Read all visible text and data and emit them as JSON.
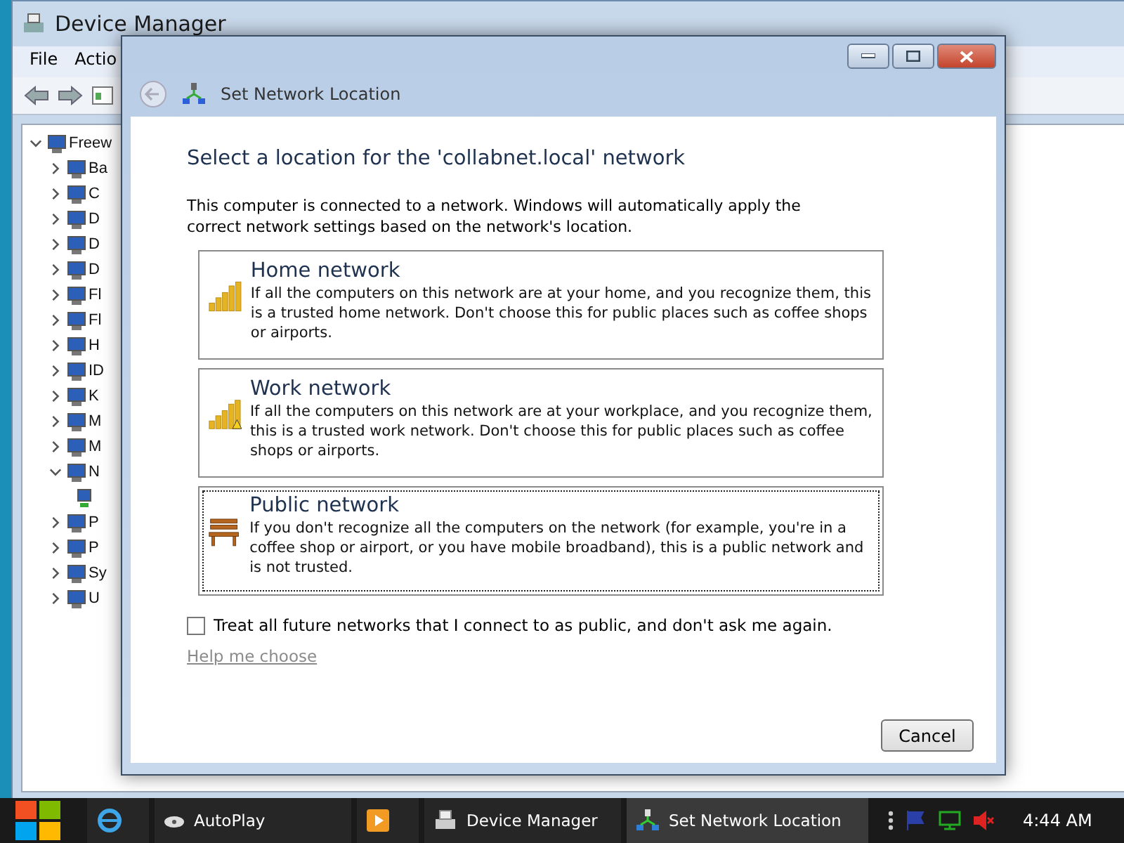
{
  "device_manager": {
    "title": "Device Manager",
    "menu": [
      "File",
      "Actio"
    ],
    "tree": [
      {
        "label": "Freew",
        "expanded": true,
        "children": [
          {
            "label": "Ba",
            "expanded": false
          },
          {
            "label": "C",
            "expanded": false
          },
          {
            "label": "D",
            "expanded": false
          },
          {
            "label": "D",
            "expanded": false
          },
          {
            "label": "D",
            "expanded": false
          },
          {
            "label": "Fl",
            "expanded": false
          },
          {
            "label": "Fl",
            "expanded": false
          },
          {
            "label": "H",
            "expanded": false
          },
          {
            "label": "ID",
            "expanded": false
          },
          {
            "label": "K",
            "expanded": false
          },
          {
            "label": "M",
            "expanded": false
          },
          {
            "label": "M",
            "expanded": false
          },
          {
            "label": "N",
            "expanded": true,
            "children": [
              {
                "kind": "adapter"
              }
            ]
          },
          {
            "label": "P",
            "expanded": false
          },
          {
            "label": "P",
            "expanded": false
          },
          {
            "label": "Sy",
            "expanded": false
          },
          {
            "label": "U",
            "expanded": false
          }
        ]
      }
    ]
  },
  "dialog": {
    "title": "Set Network Location",
    "heading": "Select a location for the 'collabnet.local' network",
    "intro": "This computer is connected to a network. Windows will automatically apply the correct network settings based on the network's location.",
    "options": [
      {
        "kind": "home",
        "title": "Home network",
        "description": "If all the computers on this network are at your home, and you recognize them, this is a trusted home network.  Don't choose this for public places such as coffee shops or airports.",
        "selected": false
      },
      {
        "kind": "work",
        "title": "Work network",
        "description": "If all the computers on this network are at your workplace, and you recognize them, this is a trusted work network.  Don't choose this for public places such as coffee shops or airports.",
        "selected": false
      },
      {
        "kind": "public",
        "title": "Public network",
        "description": "If you don't recognize all the computers on the network (for example, you're in a coffee shop or airport, or you have mobile broadband), this is a public network and is not trusted.",
        "selected": true
      }
    ],
    "checkbox": {
      "label": "Treat all future networks that I connect to as public, and don't ask me again.",
      "checked": false
    },
    "help_link": "Help me choose",
    "cancel": "Cancel"
  },
  "taskbar": {
    "items": [
      {
        "kind": "ie",
        "selected": false
      },
      {
        "kind": "autoplay",
        "label": "AutoPlay",
        "selected": false
      },
      {
        "kind": "media",
        "selected": false
      },
      {
        "kind": "devmgr",
        "label": "Device Manager",
        "selected": false
      },
      {
        "kind": "network",
        "label": "Set Network Location",
        "selected": true
      }
    ],
    "clock": "4:44 AM"
  }
}
